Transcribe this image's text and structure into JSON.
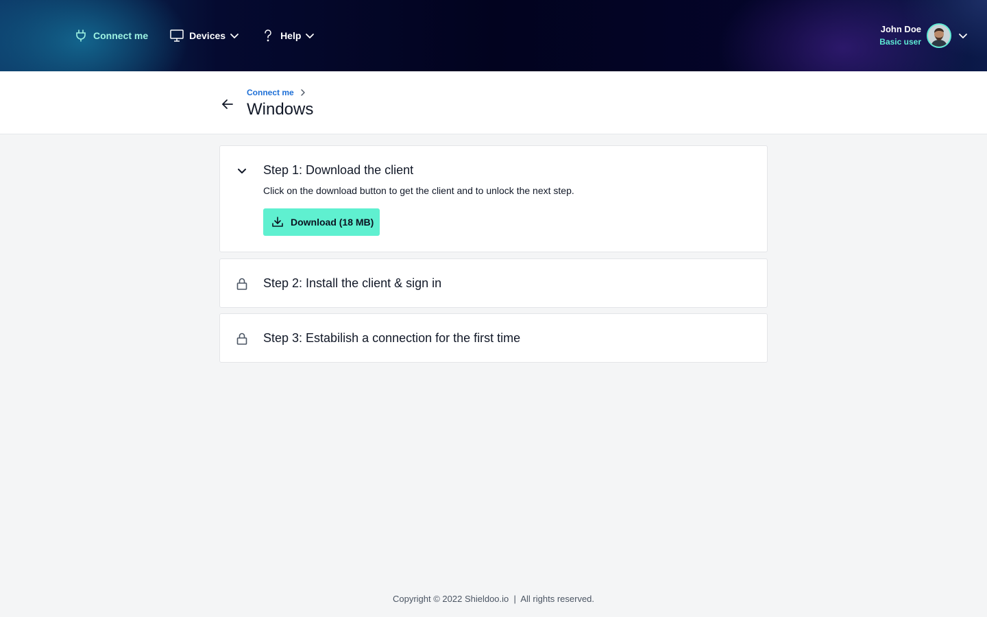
{
  "nav": {
    "items": [
      {
        "label": "Connect me"
      },
      {
        "label": "Devices"
      },
      {
        "label": "Help"
      }
    ]
  },
  "user": {
    "name": "John Doe",
    "role": "Basic user"
  },
  "breadcrumb": {
    "parent": "Connect me"
  },
  "page": {
    "title": "Windows"
  },
  "steps": [
    {
      "title": "Step 1: Download the client",
      "description": "Click on the download button to get the client and to unlock the next step.",
      "button_label": "Download (18 MB)",
      "state": "expanded"
    },
    {
      "title": "Step 2: Install the client & sign in",
      "state": "locked"
    },
    {
      "title": "Step 3: Estabilish a connection for the first time",
      "state": "locked"
    }
  ],
  "footer": {
    "text": "Copyright © 2022 Shieldoo.io  |  All rights reserved."
  },
  "colors": {
    "accent": "#5ff0d0",
    "active_nav": "#9ef3e2",
    "link": "#1d6fd6",
    "header_dark": "#02031f"
  }
}
